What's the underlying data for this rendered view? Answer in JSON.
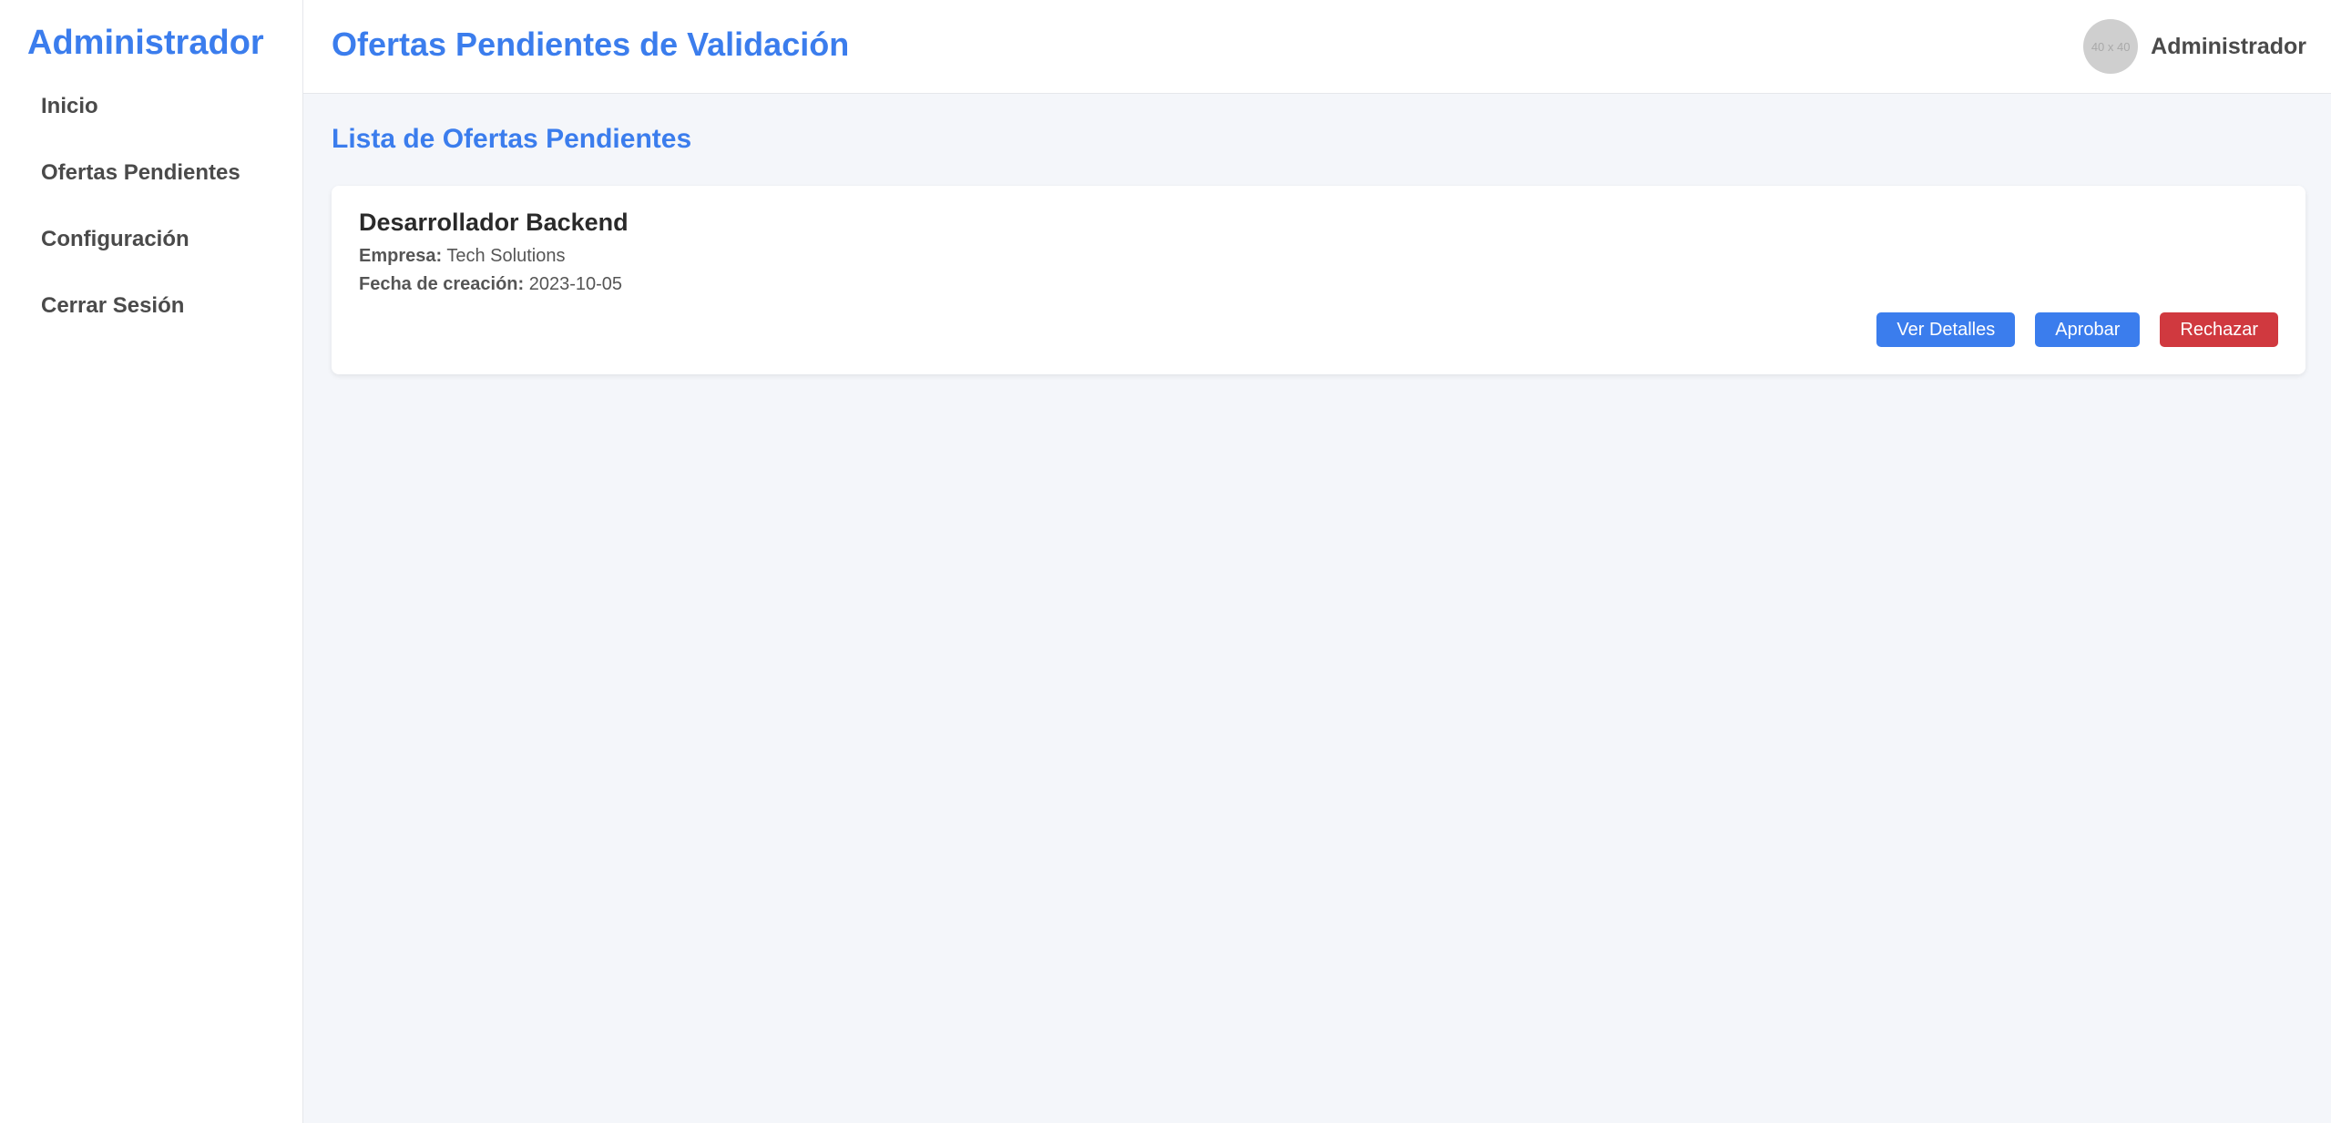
{
  "sidebar": {
    "brand": "Administrador",
    "items": [
      {
        "label": "Inicio"
      },
      {
        "label": "Ofertas Pendientes"
      },
      {
        "label": "Configuración"
      },
      {
        "label": "Cerrar Sesión"
      }
    ]
  },
  "header": {
    "title": "Ofertas Pendientes de Validación",
    "avatar_placeholder": "40 x 40",
    "user_name": "Administrador"
  },
  "main": {
    "section_title": "Lista de Ofertas Pendientes",
    "offers": [
      {
        "title": "Desarrollador Backend",
        "company_label": "Empresa:",
        "company": "Tech Solutions",
        "date_label": "Fecha de creación:",
        "date": "2023-10-05",
        "actions": {
          "details": "Ver Detalles",
          "approve": "Aprobar",
          "reject": "Rechazar"
        }
      }
    ]
  },
  "colors": {
    "accent": "#3b7ded",
    "danger": "#d0393f",
    "background": "#f4f6fa"
  }
}
